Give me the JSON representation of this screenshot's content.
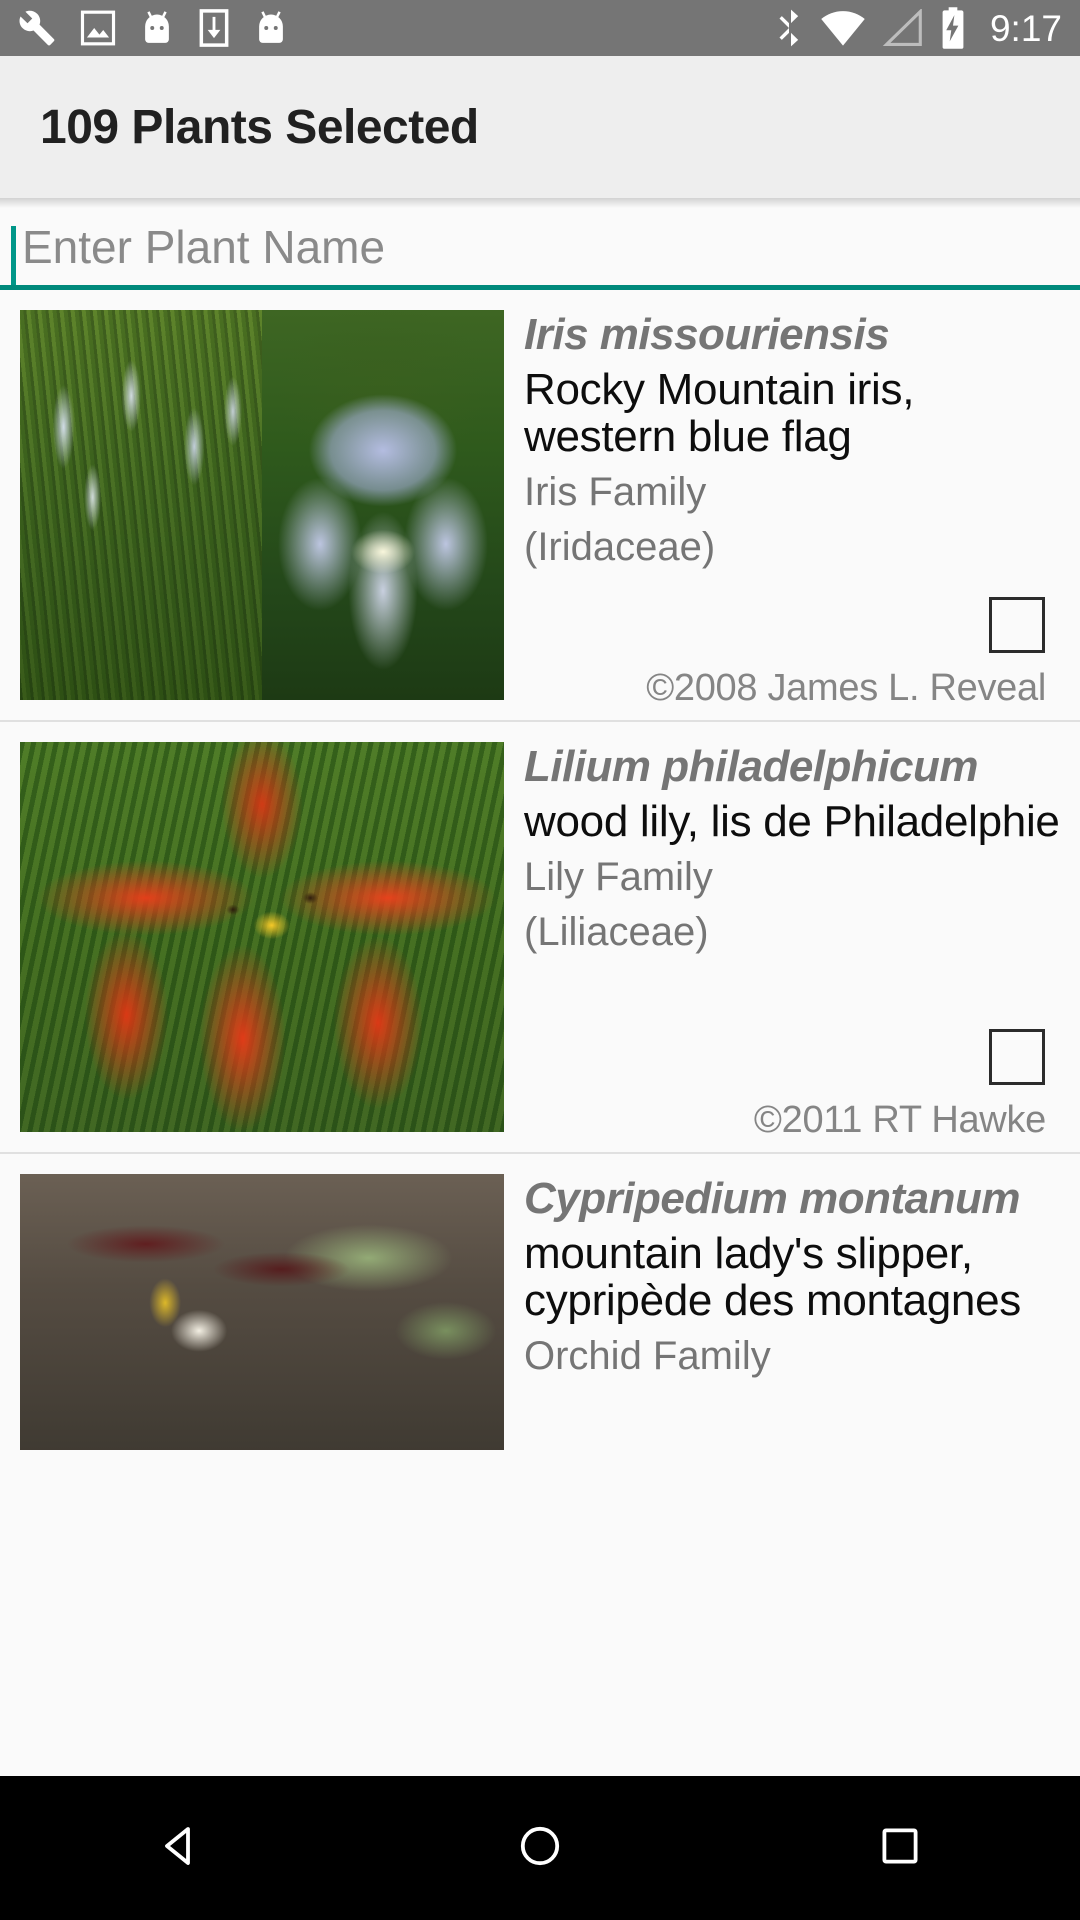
{
  "status_bar": {
    "time": "9:17",
    "left_icons": [
      "wrench-icon",
      "image-icon",
      "android-head-icon",
      "download-icon",
      "android-head-icon"
    ],
    "right_icons": [
      "bluetooth-icon",
      "wifi-icon",
      "cell-signal-empty-icon",
      "battery-charging-icon"
    ],
    "background": "#757575"
  },
  "app_bar": {
    "title": "109 Plants Selected",
    "background": "#eeeeee"
  },
  "search": {
    "value": "",
    "placeholder": "Enter Plant Name",
    "accent": "#009688"
  },
  "list": {
    "rows": [
      {
        "scientific_name": "Iris missouriensis",
        "common_names": "Rocky Mountain iris, western blue flag",
        "family": "Iris Family",
        "family_latin": "(Iridaceae)",
        "copyright": "©2008 James L. Reveal",
        "checked": false,
        "images": [
          "iris-field-photo",
          "iris-flower-photo"
        ]
      },
      {
        "scientific_name": "Lilium philadelphicum",
        "common_names": "wood lily, lis de Philadelphie",
        "family": "Lily Family",
        "family_latin": "(Liliaceae)",
        "copyright": "©2011 RT Hawke",
        "checked": false,
        "images": [
          "wood-lily-photo"
        ]
      },
      {
        "scientific_name": "Cypripedium montanum",
        "common_names": "mountain lady's slipper, cypripède des montagnes",
        "family": "Orchid Family",
        "family_latin": "",
        "copyright": "",
        "checked": false,
        "images": [
          "mountain-ladys-slipper-photo"
        ]
      }
    ]
  },
  "nav_bar": {
    "back_label": "back-button",
    "home_label": "home-button",
    "recents_label": "recents-button",
    "background": "#000000"
  }
}
